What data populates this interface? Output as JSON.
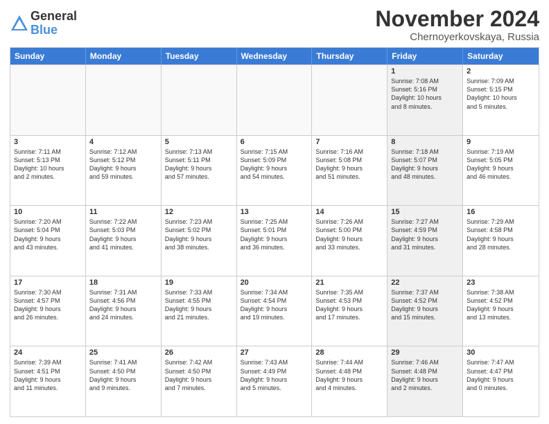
{
  "logo": {
    "general": "General",
    "blue": "Blue"
  },
  "title": "November 2024",
  "location": "Chernoyerkovskaya, Russia",
  "days": [
    "Sunday",
    "Monday",
    "Tuesday",
    "Wednesday",
    "Thursday",
    "Friday",
    "Saturday"
  ],
  "rows": [
    [
      {
        "day": "",
        "text": "",
        "empty": true
      },
      {
        "day": "",
        "text": "",
        "empty": true
      },
      {
        "day": "",
        "text": "",
        "empty": true
      },
      {
        "day": "",
        "text": "",
        "empty": true
      },
      {
        "day": "",
        "text": "",
        "empty": true
      },
      {
        "day": "1",
        "text": "Sunrise: 7:08 AM\nSunset: 5:16 PM\nDaylight: 10 hours\nand 8 minutes.",
        "shaded": true
      },
      {
        "day": "2",
        "text": "Sunrise: 7:09 AM\nSunset: 5:15 PM\nDaylight: 10 hours\nand 5 minutes.",
        "shaded": false
      }
    ],
    [
      {
        "day": "3",
        "text": "Sunrise: 7:11 AM\nSunset: 5:13 PM\nDaylight: 10 hours\nand 2 minutes.",
        "shaded": false
      },
      {
        "day": "4",
        "text": "Sunrise: 7:12 AM\nSunset: 5:12 PM\nDaylight: 9 hours\nand 59 minutes.",
        "shaded": false
      },
      {
        "day": "5",
        "text": "Sunrise: 7:13 AM\nSunset: 5:11 PM\nDaylight: 9 hours\nand 57 minutes.",
        "shaded": false
      },
      {
        "day": "6",
        "text": "Sunrise: 7:15 AM\nSunset: 5:09 PM\nDaylight: 9 hours\nand 54 minutes.",
        "shaded": false
      },
      {
        "day": "7",
        "text": "Sunrise: 7:16 AM\nSunset: 5:08 PM\nDaylight: 9 hours\nand 51 minutes.",
        "shaded": false
      },
      {
        "day": "8",
        "text": "Sunrise: 7:18 AM\nSunset: 5:07 PM\nDaylight: 9 hours\nand 48 minutes.",
        "shaded": true
      },
      {
        "day": "9",
        "text": "Sunrise: 7:19 AM\nSunset: 5:05 PM\nDaylight: 9 hours\nand 46 minutes.",
        "shaded": false
      }
    ],
    [
      {
        "day": "10",
        "text": "Sunrise: 7:20 AM\nSunset: 5:04 PM\nDaylight: 9 hours\nand 43 minutes.",
        "shaded": false
      },
      {
        "day": "11",
        "text": "Sunrise: 7:22 AM\nSunset: 5:03 PM\nDaylight: 9 hours\nand 41 minutes.",
        "shaded": false
      },
      {
        "day": "12",
        "text": "Sunrise: 7:23 AM\nSunset: 5:02 PM\nDaylight: 9 hours\nand 38 minutes.",
        "shaded": false
      },
      {
        "day": "13",
        "text": "Sunrise: 7:25 AM\nSunset: 5:01 PM\nDaylight: 9 hours\nand 36 minutes.",
        "shaded": false
      },
      {
        "day": "14",
        "text": "Sunrise: 7:26 AM\nSunset: 5:00 PM\nDaylight: 9 hours\nand 33 minutes.",
        "shaded": false
      },
      {
        "day": "15",
        "text": "Sunrise: 7:27 AM\nSunset: 4:59 PM\nDaylight: 9 hours\nand 31 minutes.",
        "shaded": true
      },
      {
        "day": "16",
        "text": "Sunrise: 7:29 AM\nSunset: 4:58 PM\nDaylight: 9 hours\nand 28 minutes.",
        "shaded": false
      }
    ],
    [
      {
        "day": "17",
        "text": "Sunrise: 7:30 AM\nSunset: 4:57 PM\nDaylight: 9 hours\nand 26 minutes.",
        "shaded": false
      },
      {
        "day": "18",
        "text": "Sunrise: 7:31 AM\nSunset: 4:56 PM\nDaylight: 9 hours\nand 24 minutes.",
        "shaded": false
      },
      {
        "day": "19",
        "text": "Sunrise: 7:33 AM\nSunset: 4:55 PM\nDaylight: 9 hours\nand 21 minutes.",
        "shaded": false
      },
      {
        "day": "20",
        "text": "Sunrise: 7:34 AM\nSunset: 4:54 PM\nDaylight: 9 hours\nand 19 minutes.",
        "shaded": false
      },
      {
        "day": "21",
        "text": "Sunrise: 7:35 AM\nSunset: 4:53 PM\nDaylight: 9 hours\nand 17 minutes.",
        "shaded": false
      },
      {
        "day": "22",
        "text": "Sunrise: 7:37 AM\nSunset: 4:52 PM\nDaylight: 9 hours\nand 15 minutes.",
        "shaded": true
      },
      {
        "day": "23",
        "text": "Sunrise: 7:38 AM\nSunset: 4:52 PM\nDaylight: 9 hours\nand 13 minutes.",
        "shaded": false
      }
    ],
    [
      {
        "day": "24",
        "text": "Sunrise: 7:39 AM\nSunset: 4:51 PM\nDaylight: 9 hours\nand 11 minutes.",
        "shaded": false
      },
      {
        "day": "25",
        "text": "Sunrise: 7:41 AM\nSunset: 4:50 PM\nDaylight: 9 hours\nand 9 minutes.",
        "shaded": false
      },
      {
        "day": "26",
        "text": "Sunrise: 7:42 AM\nSunset: 4:50 PM\nDaylight: 9 hours\nand 7 minutes.",
        "shaded": false
      },
      {
        "day": "27",
        "text": "Sunrise: 7:43 AM\nSunset: 4:49 PM\nDaylight: 9 hours\nand 5 minutes.",
        "shaded": false
      },
      {
        "day": "28",
        "text": "Sunrise: 7:44 AM\nSunset: 4:48 PM\nDaylight: 9 hours\nand 4 minutes.",
        "shaded": false
      },
      {
        "day": "29",
        "text": "Sunrise: 7:46 AM\nSunset: 4:48 PM\nDaylight: 9 hours\nand 2 minutes.",
        "shaded": true
      },
      {
        "day": "30",
        "text": "Sunrise: 7:47 AM\nSunset: 4:47 PM\nDaylight: 9 hours\nand 0 minutes.",
        "shaded": false
      }
    ]
  ]
}
